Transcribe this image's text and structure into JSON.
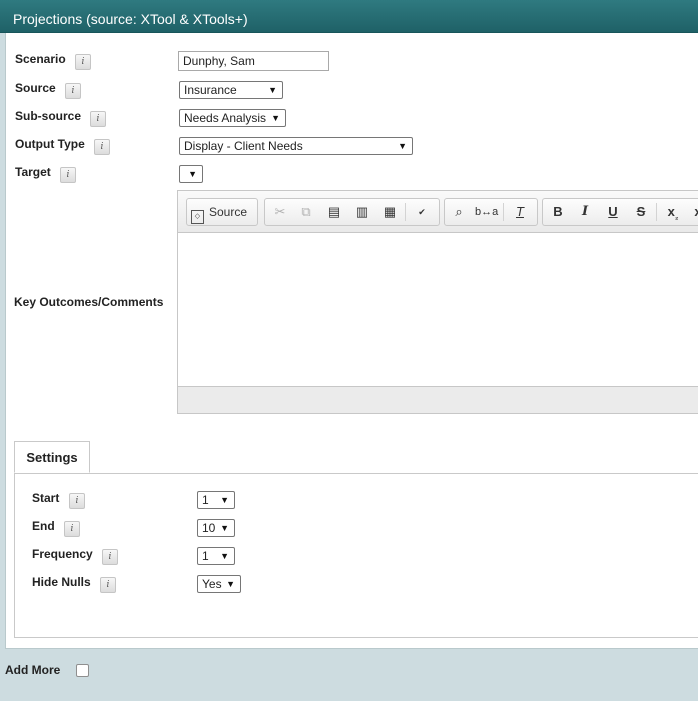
{
  "window": {
    "title": "Projections (source: XTool & XTools+)"
  },
  "form": {
    "scenario": {
      "label": "Scenario",
      "value": "Dunphy, Sam"
    },
    "source": {
      "label": "Source",
      "value": "Insurance"
    },
    "sub_source": {
      "label": "Sub-source",
      "value": "Needs Analysis"
    },
    "output_type": {
      "label": "Output Type",
      "value": "Display - Client Needs"
    },
    "target": {
      "label": "Target",
      "value": ""
    },
    "key_outcomes": {
      "label": "Key Outcomes/Comments"
    }
  },
  "editor_toolbar": {
    "source_label": "Source",
    "icons": [
      "source-icon",
      "cut-icon",
      "copy-icon",
      "paste-icon",
      "paste-text-icon",
      "paste-word-icon",
      "spellcheck-icon",
      "find-icon",
      "replace-icon",
      "remove-format-icon",
      "bold-icon",
      "italic-icon",
      "underline-icon",
      "strikethrough-icon",
      "subscript-icon"
    ]
  },
  "settings": {
    "tab_label": "Settings",
    "start": {
      "label": "Start",
      "value": "1"
    },
    "end": {
      "label": "End",
      "value": "10"
    },
    "frequency": {
      "label": "Frequency",
      "value": "1"
    },
    "hide_nulls": {
      "label": "Hide Nulls",
      "value": "Yes"
    }
  },
  "footer": {
    "add_more_label": "Add More",
    "add_more_checked": false
  },
  "info_glyph": "i",
  "colors": {
    "title_bar": "#236b71",
    "background": "#cddce0"
  }
}
